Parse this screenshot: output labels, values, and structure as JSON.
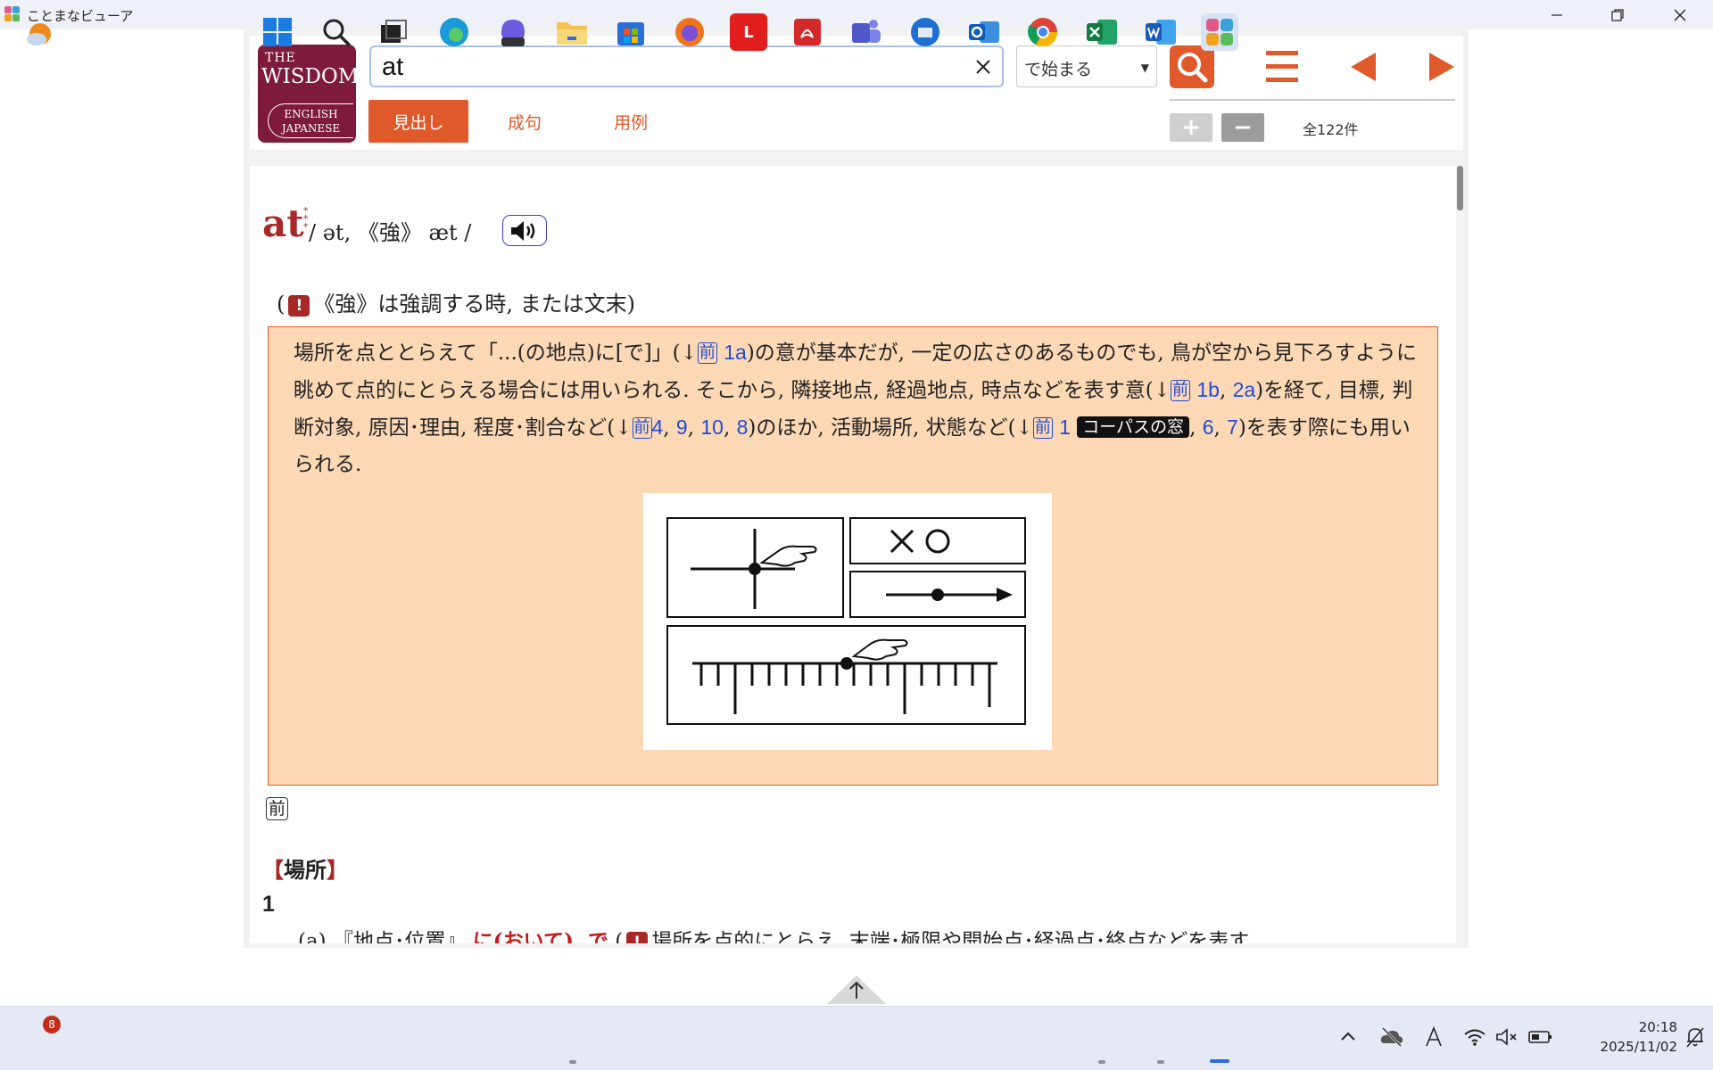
{
  "window": {
    "title": "ことまなビューア"
  },
  "logo": {
    "the": "THE",
    "wisdom": "WISDOM",
    "line1": "ENGLISH",
    "line2": "JAPANESE"
  },
  "search": {
    "query": "at",
    "match_mode": "で始まる"
  },
  "tabs": [
    {
      "label": "見出し",
      "active": true
    },
    {
      "label": "成句",
      "active": false
    },
    {
      "label": "用例",
      "active": false
    }
  ],
  "toolbar": {
    "zoom_in": "+",
    "zoom_out": "−",
    "result_count": "全122件"
  },
  "entry": {
    "headword": "at",
    "stars": "***",
    "pronunciation": "/ ət, 《強》 æt /",
    "note_open": "(",
    "note_mark": "!",
    "note_text": "《強》は強調する時, または文末)",
    "core": {
      "p1": "場所を点ととらえて「...(の地点)に[で]」(↓",
      "r1": "1a",
      "p2": ")の意が基本だが, 一定の広さのあるものでも, 鳥が空から見下ろすように眺めて点的にとらえる場合には用いられる. そこから, 隣接地点, 経過地点, 時点などを表す意(↓",
      "r2": "1b",
      "r3": "2a",
      "p3": ")を経て, 目標, 判断対象, 原因･理由, 程度･割合など(↓",
      "r4": "4",
      "r5": "9",
      "r6": "10",
      "r7": "8",
      "p4": ")のほか, 活動場所, 状態など(↓",
      "r8": "1",
      "corpus": "コーパスの窓",
      "r9": "6",
      "r10": "7",
      "p5": ")を表す際にも用いられる.",
      "mae": "前",
      "comma": ", "
    },
    "pos_mark": "前",
    "section": {
      "open": "【",
      "text": "場所",
      "close": "】"
    },
    "sense_number": "1",
    "sense_line": {
      "a": "(a) 『地点･位置』",
      "b": "に(おいて)",
      "c": ", で",
      "d": " (",
      "e": "!",
      "f": "場所を点的にとらえ, 末端･極限や開始点･経過点･終点などを表す"
    }
  },
  "clock": {
    "time": "20:18",
    "date": "2025/11/02"
  },
  "taskbar": {
    "weather_badge": "8",
    "lexi_label": "L"
  },
  "colors": {
    "accent": "#e0592a",
    "headword": "#a82727",
    "link": "#1f4bd6",
    "core_bg": "#fdd8b5",
    "logo": "#7e1a3c"
  }
}
